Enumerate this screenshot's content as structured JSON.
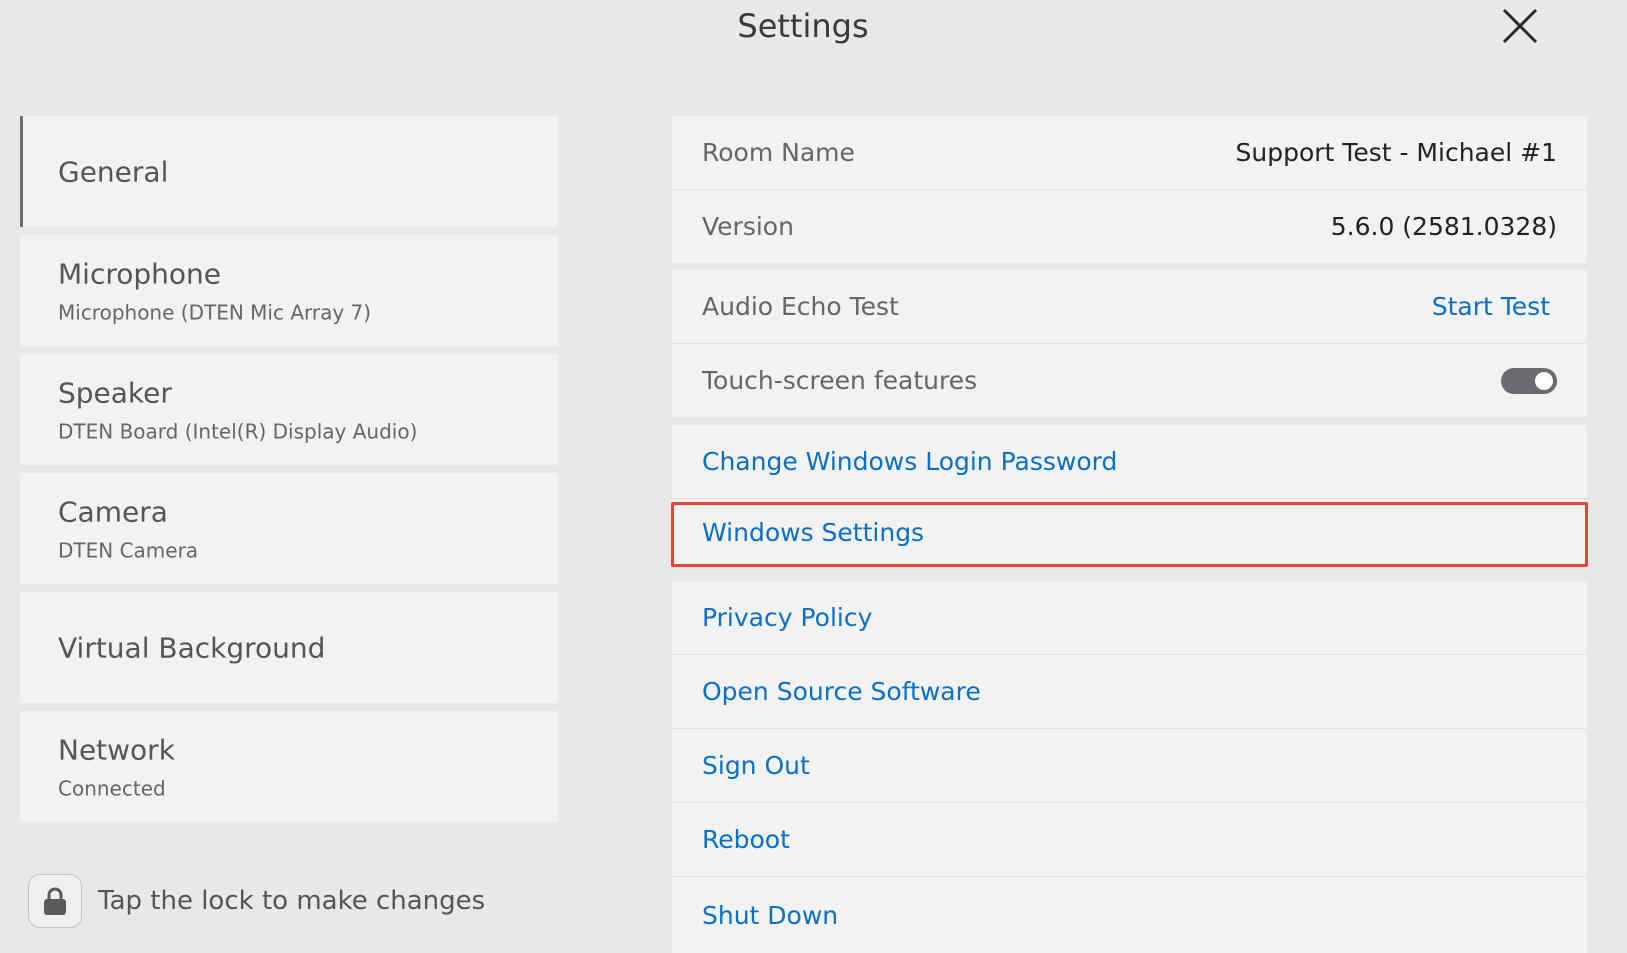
{
  "header": {
    "title": "Settings"
  },
  "sidebar": {
    "items": [
      {
        "title": "General",
        "subtitle": ""
      },
      {
        "title": "Microphone",
        "subtitle": "Microphone (DTEN Mic Array 7)"
      },
      {
        "title": "Speaker",
        "subtitle": "DTEN Board (Intel(R) Display Audio)"
      },
      {
        "title": "Camera",
        "subtitle": "DTEN Camera"
      },
      {
        "title": "Virtual Background",
        "subtitle": ""
      },
      {
        "title": "Network",
        "subtitle": "Connected"
      }
    ]
  },
  "lock": {
    "label": "Tap the lock to make changes"
  },
  "general": {
    "room_name": {
      "label": "Room Name",
      "value": "Support Test - Michael #1"
    },
    "version": {
      "label": "Version",
      "value": "5.6.0 (2581.0328)"
    },
    "audio_echo": {
      "label": "Audio Echo Test",
      "action": "Start Test"
    },
    "touch_screen": {
      "label": "Touch-screen features",
      "enabled": true
    },
    "links": [
      "Change Windows Login Password",
      "Windows Settings",
      "Privacy Policy",
      "Open Source Software",
      "Sign Out",
      "Reboot",
      "Shut Down"
    ]
  },
  "colors": {
    "link": "#0b6fc4",
    "highlight": "#e0483c",
    "toggle_on": "#6a6a6f"
  }
}
